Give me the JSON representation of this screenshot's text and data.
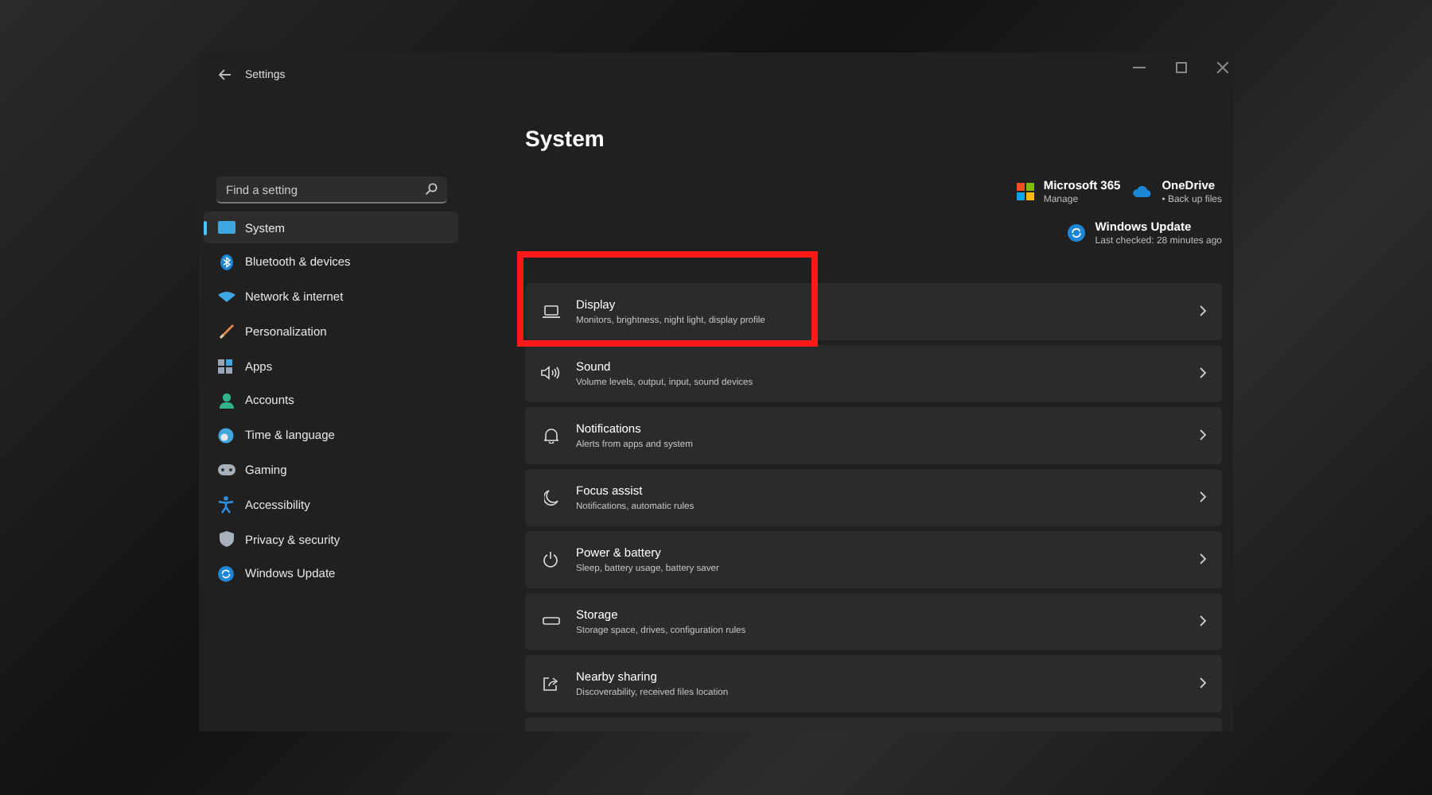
{
  "window": {
    "title": "Settings"
  },
  "search": {
    "placeholder": "Find a setting"
  },
  "sidebar": {
    "items": [
      {
        "label": "System",
        "selected": true
      },
      {
        "label": "Bluetooth & devices",
        "selected": false
      },
      {
        "label": "Network & internet",
        "selected": false
      },
      {
        "label": "Personalization",
        "selected": false
      },
      {
        "label": "Apps",
        "selected": false
      },
      {
        "label": "Accounts",
        "selected": false
      },
      {
        "label": "Time & language",
        "selected": false
      },
      {
        "label": "Gaming",
        "selected": false
      },
      {
        "label": "Accessibility",
        "selected": false
      },
      {
        "label": "Privacy & security",
        "selected": false
      },
      {
        "label": "Windows Update",
        "selected": false
      }
    ]
  },
  "page_title": "System",
  "widgets": [
    {
      "title": "Microsoft 365",
      "subtitle": "Manage"
    },
    {
      "title": "OneDrive",
      "subtitle": "• Back up files"
    },
    {
      "title": "Windows Update",
      "subtitle": "Last checked: 28 minutes ago"
    }
  ],
  "settings": [
    {
      "title": "Display",
      "subtitle": "Monitors, brightness, night light, display profile",
      "highlighted": true
    },
    {
      "title": "Sound",
      "subtitle": "Volume levels, output, input, sound devices",
      "highlighted": false
    },
    {
      "title": "Notifications",
      "subtitle": "Alerts from apps and system",
      "highlighted": false
    },
    {
      "title": "Focus assist",
      "subtitle": "Notifications, automatic rules",
      "highlighted": false
    },
    {
      "title": "Power & battery",
      "subtitle": "Sleep, battery usage, battery saver",
      "highlighted": false
    },
    {
      "title": "Storage",
      "subtitle": "Storage space, drives, configuration rules",
      "highlighted": false
    },
    {
      "title": "Nearby sharing",
      "subtitle": "Discoverability, received files location",
      "highlighted": false
    }
  ]
}
